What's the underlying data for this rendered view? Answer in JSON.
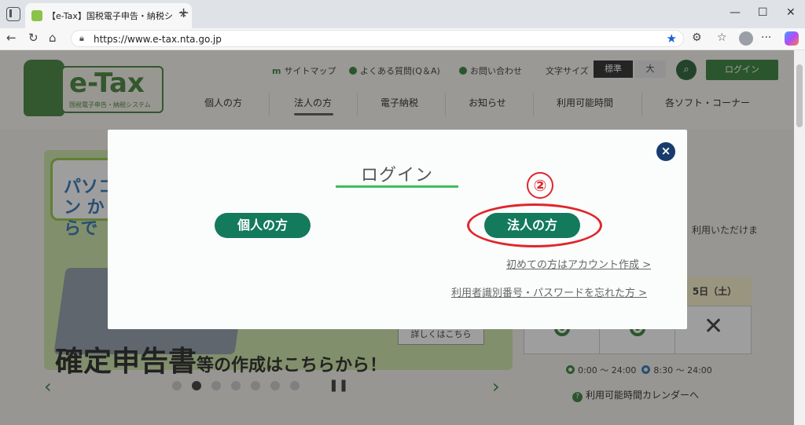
{
  "browser": {
    "tab_title": "【e-Tax】国税電子申告・納税システム",
    "tab_close": "✕",
    "new_tab": "+",
    "url": "https://www.e-tax.nta.go.jp",
    "minimize": "—",
    "maximize": "☐",
    "close": "✕"
  },
  "header": {
    "logo_text": "e-Tax",
    "logo_sub": "国税電子申告・納税システム",
    "sitemap": "サイトマップ",
    "faq": "よくある質問(Q＆A)",
    "contact": "お問い合わせ",
    "font_size_label": "文字サイズ",
    "font_std": "標準",
    "font_large": "大",
    "login": "ログイン",
    "nav": [
      "個人の方",
      "法人の方",
      "電子納税",
      "お知らせ",
      "利用可能時間",
      "各ソフト・コーナー"
    ]
  },
  "hero": {
    "balloon": "パソコン からで",
    "caption_main": "確定申告書",
    "caption_rest": "等の作成はこちらから！",
    "detail": "詳しくはこちら"
  },
  "availability": {
    "text_partial": "利用いただけま",
    "date": "5日（土）",
    "legend_1": "0:00 ～ 24:00",
    "legend_2": "8:30 ～ 24:00",
    "calendar_link": "利用可能時間カレンダーへ"
  },
  "modal": {
    "title": "ログイン",
    "close": "×",
    "personal_btn": "個人の方",
    "corp_btn": "法人の方",
    "step": "②",
    "link_account": "初めての方はアカウント作成 >",
    "link_forgot": "利用者識別番号・パスワードを忘れた方 >"
  },
  "colors": {
    "brand_green": "#137a5c",
    "highlight_red": "#e0262b",
    "close_navy": "#173b6d"
  }
}
